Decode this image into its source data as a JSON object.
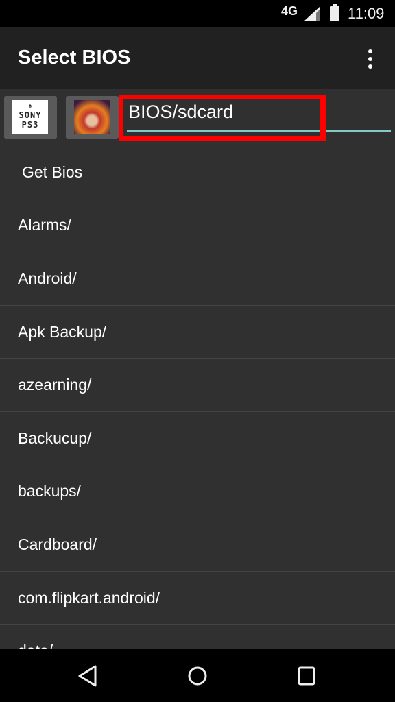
{
  "status_bar": {
    "network": "4G",
    "time": "11:09",
    "signal_icon": "signal-icon",
    "battery_icon": "battery-icon"
  },
  "app_bar": {
    "title": "Select BIOS",
    "menu_icon": "more-vert-icon"
  },
  "path_row": {
    "ps3_logo_text": "SONY PS3",
    "path_value": "BIOS/sdcard"
  },
  "list": {
    "items": [
      "Get Bios",
      "Alarms/",
      "Android/",
      "Apk Backup/",
      "azearning/",
      "Backucup/",
      "backups/",
      "Cardboard/",
      "com.flipkart.android/",
      "data/"
    ]
  },
  "nav_bar": {
    "back_icon": "back-icon",
    "home_icon": "home-icon",
    "recents_icon": "recents-icon"
  },
  "colors": {
    "highlight": "#ff0000",
    "underline": "#80cbc4",
    "app_bar": "#212121",
    "background": "#303030"
  }
}
